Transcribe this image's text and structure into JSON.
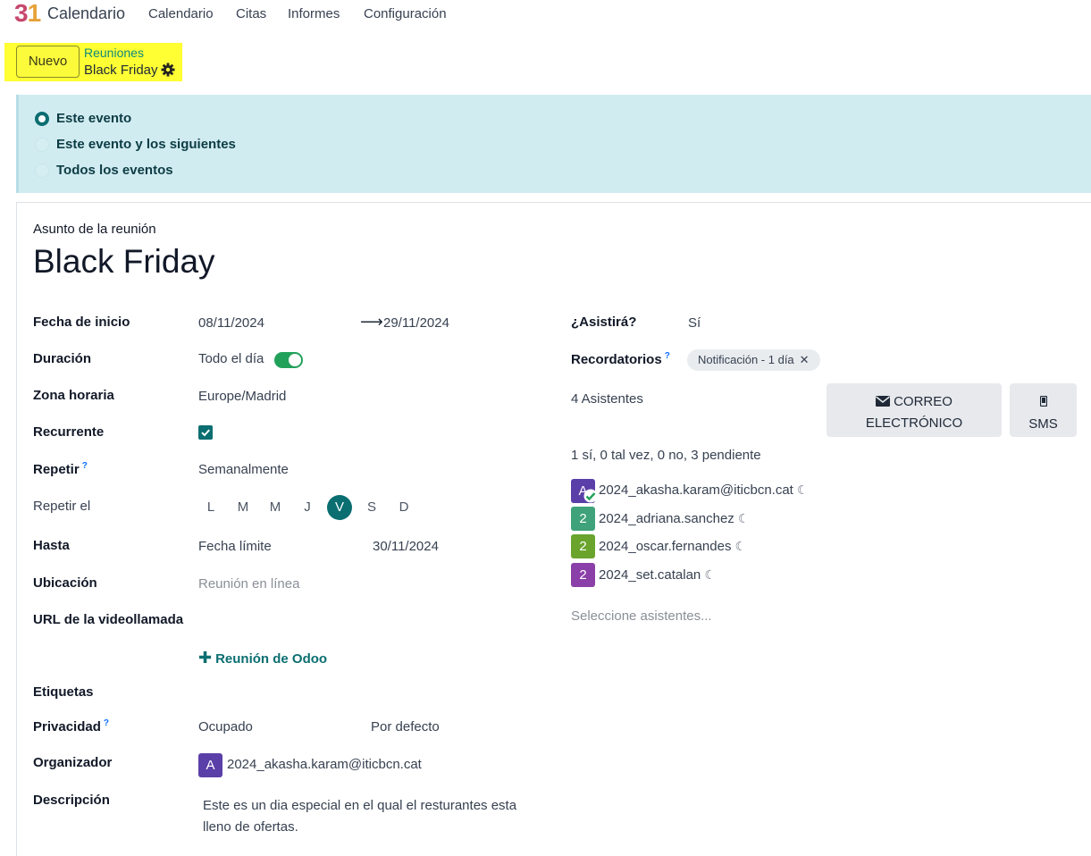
{
  "nav": {
    "logo_3": "3",
    "logo_1": "1",
    "app_title": "Calendario",
    "menu": [
      "Calendario",
      "Citas",
      "Informes",
      "Configuración"
    ]
  },
  "control": {
    "new_button": "Nuevo",
    "breadcrumb_parent": "Reuniones",
    "breadcrumb_current": "Black Friday"
  },
  "recurrence_update": {
    "options": [
      "Este evento",
      "Este evento y los siguientes",
      "Todos los eventos"
    ],
    "selected_index": 0
  },
  "form": {
    "subject_label": "Asunto de la reunión",
    "subject": "Black Friday",
    "start_label": "Fecha de inicio",
    "start_date": "08/11/2024",
    "end_date": "29/11/2024",
    "arrow": "⟶",
    "duration_label": "Duración",
    "all_day_label": "Todo el día",
    "all_day": true,
    "timezone_label": "Zona horaria",
    "timezone": "Europe/Madrid",
    "recurrent_label": "Recurrente",
    "recurrent": true,
    "repeat_label": "Repetir",
    "repeat_help": "?",
    "repeat_value": "Semanalmente",
    "repeat_on_label": "Repetir el",
    "weekdays": [
      "L",
      "M",
      "M",
      "J",
      "V",
      "S",
      "D"
    ],
    "weekday_selected_index": 4,
    "until_label": "Hasta",
    "until_type": "Fecha límite",
    "until_date": "30/11/2024",
    "location_label": "Ubicación",
    "location_placeholder": "Reunión en línea",
    "video_url_label": "URL de la videollamada",
    "odoo_meeting_link": "Reunión de Odoo",
    "tags_label": "Etiquetas",
    "privacy_label": "Privacidad",
    "privacy_help": "?",
    "show_as": "Ocupado",
    "privacy_value": "Por defecto",
    "organizer_label": "Organizador",
    "organizer_initial": "A",
    "organizer_name": "2024_akasha.karam@iticbcn.cat",
    "description_label": "Descripción",
    "description": "Este es un dia especial en el qual el resturantes esta lleno de ofertas."
  },
  "side": {
    "attend_label": "¿Asistirá?",
    "attend_value": "Sí",
    "reminders_label": "Recordatorios",
    "reminders_help": "?",
    "reminder_tag": "Notificación - 1 día",
    "reminder_remove": "✕",
    "attendees_count": "4 Asistentes",
    "email_button_line1": "CORREO",
    "email_button_line2": "ELECTRÓNICO",
    "sms_button": "SMS",
    "summary": "1 sí, 0 tal vez, 0 no, 3 pendiente",
    "attendees": [
      {
        "initial": "A",
        "name": "2024_akasha.karam@iticbcn.cat",
        "color": "#5b3fa8",
        "accepted": true
      },
      {
        "initial": "2",
        "name": "2024_adriana.sanchez",
        "color": "#3fa27a",
        "accepted": false
      },
      {
        "initial": "2",
        "name": "2024_oscar.fernandes",
        "color": "#6aa42d",
        "accepted": false
      },
      {
        "initial": "2",
        "name": "2024_set.catalan",
        "color": "#8b3fa8",
        "accepted": false
      }
    ],
    "select_placeholder": "Seleccione asistentes..."
  },
  "colors": {
    "primary": "#0b6e71",
    "alert_bg": "#d1ecf1",
    "highlight": "#ffff33"
  }
}
